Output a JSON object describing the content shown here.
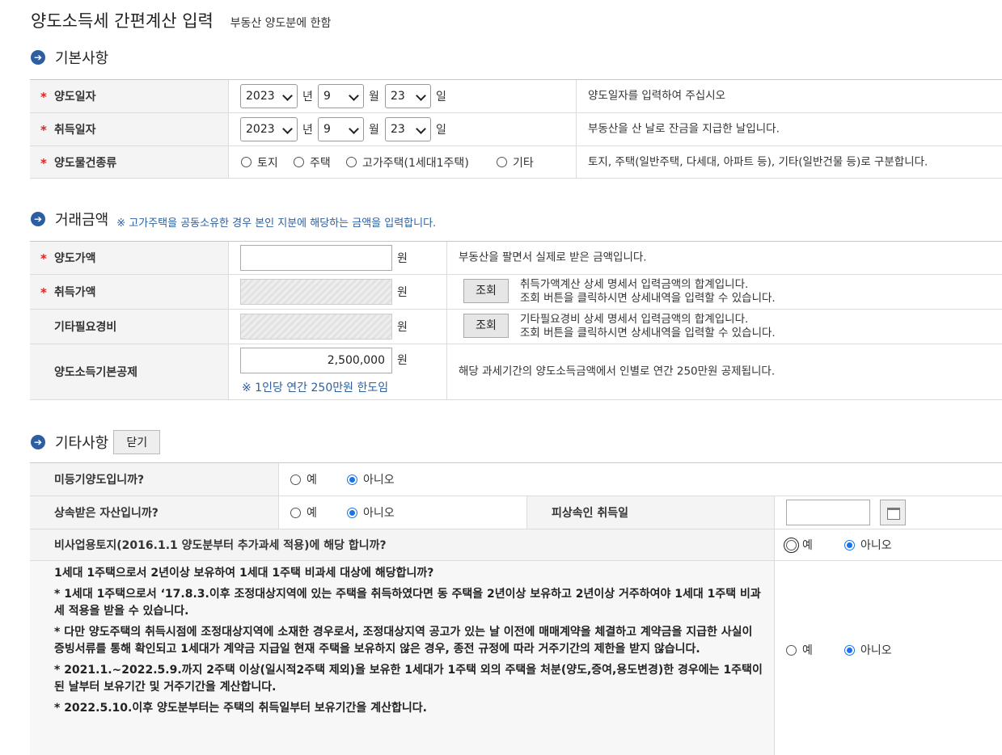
{
  "header": {
    "title": "양도소득세 간편계산 입력",
    "subtitle": "부동산 양도분에 한함"
  },
  "basic": {
    "section_title": "기본사항",
    "transfer_date": {
      "label": "양도일자",
      "year": "2023",
      "year_unit": "년",
      "month": "9",
      "month_unit": "월",
      "day": "23",
      "day_unit": "일",
      "desc": "양도일자를 입력하여 주십시오"
    },
    "acquire_date": {
      "label": "취득일자",
      "year": "2023",
      "year_unit": "년",
      "month": "9",
      "month_unit": "월",
      "day": "23",
      "day_unit": "일",
      "desc": "부동산을 산 날로 잔금을 지급한 날입니다."
    },
    "property_type": {
      "label": "양도물건종류",
      "options": [
        "토지",
        "주택",
        "고가주택(1세대1주택)",
        "기타"
      ],
      "desc": "토지, 주택(일반주택, 다세대, 아파트 등), 기타(일반건물 등)로 구분합니다."
    }
  },
  "amounts": {
    "section_title": "거래금액",
    "note": "※ 고가주택을 공동소유한 경우 본인 지분에 해당하는 금액을 입력합니다.",
    "transfer_price": {
      "label": "양도가액",
      "value": "",
      "unit": "원",
      "desc": "부동산을 팔면서 실제로 받은 금액입니다."
    },
    "acquire_price": {
      "label": "취득가액",
      "unit": "원",
      "button": "조회",
      "desc1": "취득가액계산 상세 명세서 입력금액의 합계입니다.",
      "desc2": "조회 버튼을 클릭하시면 상세내역을 입력할 수 있습니다."
    },
    "other_expense": {
      "label": "기타필요경비",
      "unit": "원",
      "button": "조회",
      "desc1": "기타필요경비 상세 명세서 입력금액의 합계입니다.",
      "desc2": "조회 버튼을 클릭하시면 상세내역을 입력할 수 있습니다."
    },
    "basic_deduction": {
      "label": "양도소득기본공제",
      "value": "2,500,000",
      "unit": "원",
      "hint": "※ 1인당 연간 250만원 한도임",
      "desc": "해당 과세기간의 양도소득금액에서 인별로 연간 250만원 공제됩니다."
    }
  },
  "other": {
    "section_title": "기타사항",
    "close_button": "닫기",
    "yes": "예",
    "no": "아니오",
    "unregistered": {
      "question": "미등기양도입니까?"
    },
    "inherited": {
      "question": "상속받은 자산입니까?",
      "decedent_label": "피상속인 취득일",
      "decedent_value": ""
    },
    "non_business_land": {
      "question": "비사업용토지(2016.1.1 양도분부터 추가과세 적용)에 해당 합니까?"
    },
    "one_house": {
      "question": "1세대 1주택으로서 2년이상 보유하여 1세대 1주택 비과세 대상에 해당합니까?",
      "notes": [
        "* 1세대 1주택으로서 ‘17.8.3.이후 조정대상지역에 있는 주택을 취득하였다면 동 주택을 2년이상 보유하고 2년이상 거주하여야 1세대 1주택 비과세 적용을 받을 수 있습니다.",
        "* 다만 양도주택의 취득시점에 조정대상지역에 소재한 경우로서, 조정대상지역 공고가 있는 날 이전에 매매계약을 체결하고 계약금을 지급한 사실이 증빙서류를 통해 확인되고 1세대가 계약금 지급일 현재 주택을 보유하지 않은 경우, 종전 규정에 따라 거주기간의 제한을 받지 않습니다.",
        "* 2021.1.~2022.5.9.까지 2주택 이상(일시적2주택 제외)을 보유한 1세대가 1주택 외의 주택을 처분(양도,증여,용도변경)한 경우에는 1주택이 된 날부터 보유기간 및 거주기간을 계산합니다.",
        "* 2022.5.10.이후 양도분부터는 주택의 취득일부터 보유기간을 계산합니다."
      ]
    }
  }
}
